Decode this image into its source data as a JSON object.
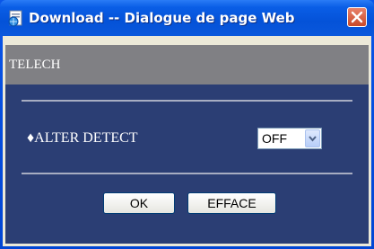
{
  "window": {
    "title": "Download -- Dialogue de page Web"
  },
  "header": {
    "label": "TELECH"
  },
  "setting": {
    "label": "♦ALTER DETECT",
    "value": "OFF"
  },
  "buttons": {
    "ok_label": "OK",
    "clear_label": "EFFACE"
  },
  "colors": {
    "titlebar": "#0a5ee6",
    "header_band": "#808084",
    "panel": "#2b3e74"
  },
  "icons": {
    "app": "web-page-icon",
    "close": "close-icon",
    "dropdown": "chevron-down-icon"
  }
}
